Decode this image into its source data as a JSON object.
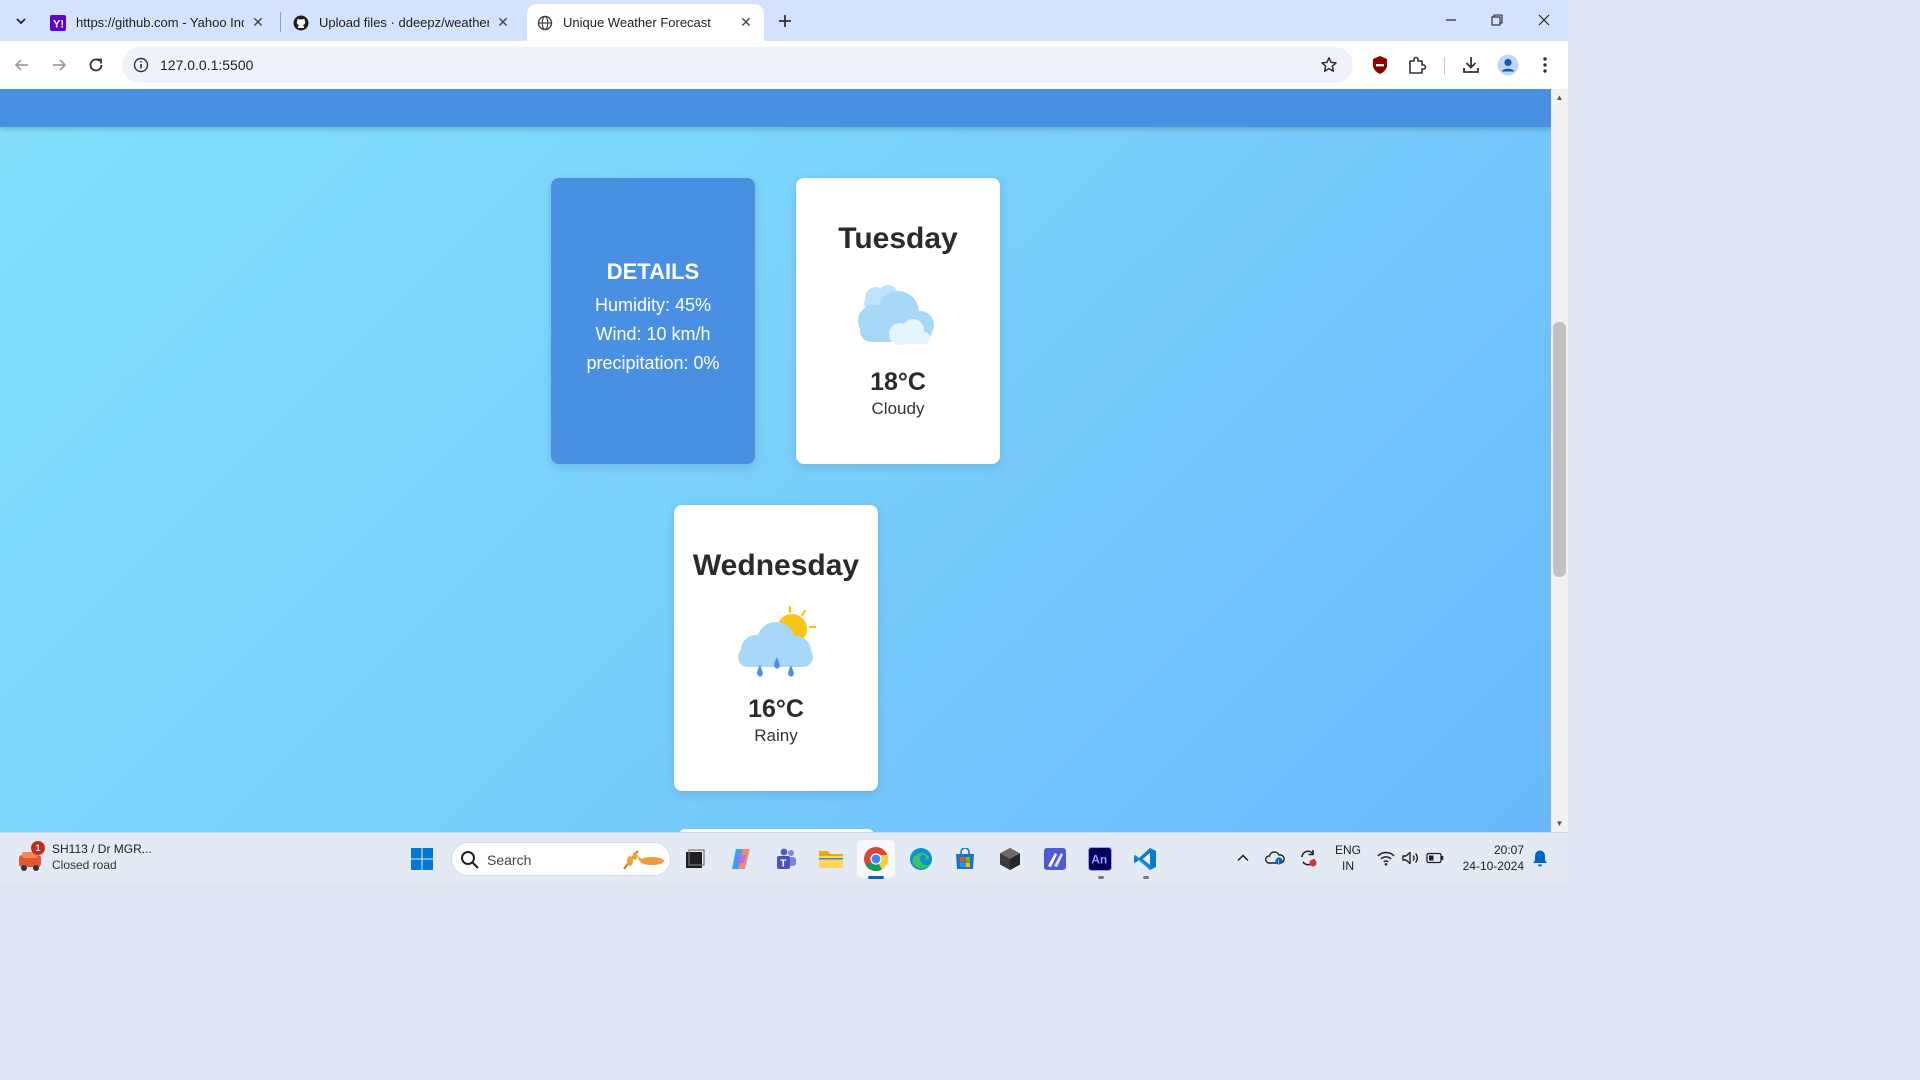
{
  "browser": {
    "tabs": [
      {
        "title": "https://github.com - Yahoo India Search",
        "favicon": "yahoo-icon"
      },
      {
        "title": "Upload files · ddeepz/weather-forecast",
        "favicon": "github-icon"
      },
      {
        "title": "Unique Weather Forecast",
        "favicon": "globe-icon",
        "active": true
      }
    ],
    "url": "127.0.0.1:5500"
  },
  "page": {
    "details": {
      "heading": "DETAILS",
      "humidity": "Humidity: 45%",
      "wind": "Wind: 10 km/h",
      "precipitation": "precipitation: 0%"
    },
    "forecast": [
      {
        "day": "Tuesday",
        "temp": "18°C",
        "condition": "Cloudy",
        "icon": "cloudy-icon"
      },
      {
        "day": "Wednesday",
        "temp": "16°C",
        "condition": "Rainy",
        "icon": "rainy-icon"
      }
    ],
    "colors": {
      "accent": "#4a90e2",
      "background_start": "#82e0fc",
      "background_end": "#6ab8fb"
    }
  },
  "taskbar": {
    "weather_widget": {
      "title": "SH113 / Dr MGR...",
      "subtitle": "Closed road",
      "badge": "1"
    },
    "search_placeholder": "Search",
    "apps": [
      "start-icon",
      "task-view-icon",
      "copilot-icon",
      "teams-icon",
      "file-explorer-icon",
      "chrome-icon",
      "edge-icon",
      "store-icon",
      "app-3d-icon",
      "app-pen-icon",
      "animate-icon",
      "vscode-icon"
    ],
    "animate_label": "An",
    "language": {
      "line1": "ENG",
      "line2": "IN"
    },
    "time": "20:07",
    "date": "24-10-2024"
  }
}
